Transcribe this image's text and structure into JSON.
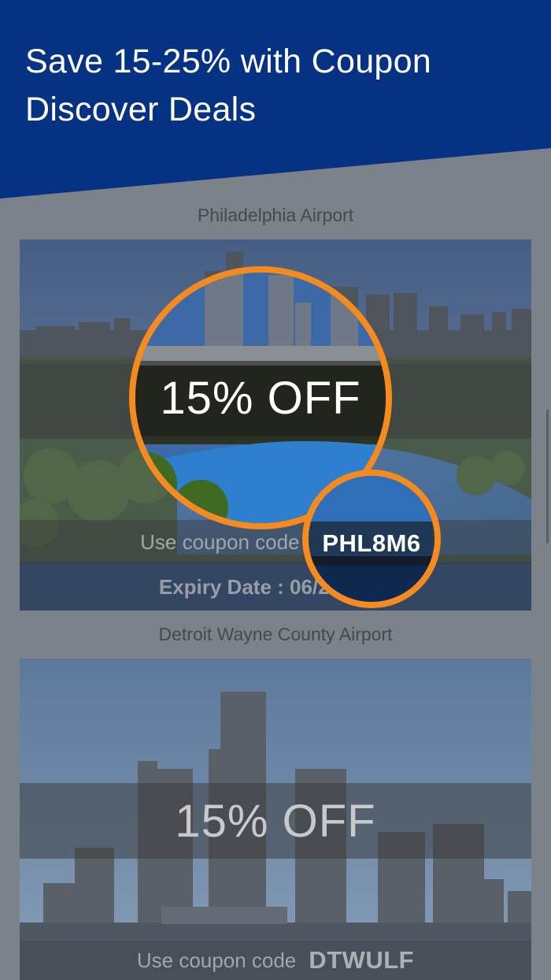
{
  "header": {
    "line1": "Save 15-25% with Coupon",
    "line2": "Discover Deals",
    "color": "#053283"
  },
  "deals": [
    {
      "airport": "Philadelphia Airport",
      "discount": "15% OFF",
      "code_prefix": "Use coupon code",
      "code": "PHL8M6",
      "expiry": "Expiry Date : 06/21/2022"
    },
    {
      "airport": "Detroit Wayne County Airport",
      "discount": "15% OFF",
      "code_prefix": "Use coupon code",
      "code": "DTWULF"
    }
  ],
  "highlight_color": "#f58a1f"
}
